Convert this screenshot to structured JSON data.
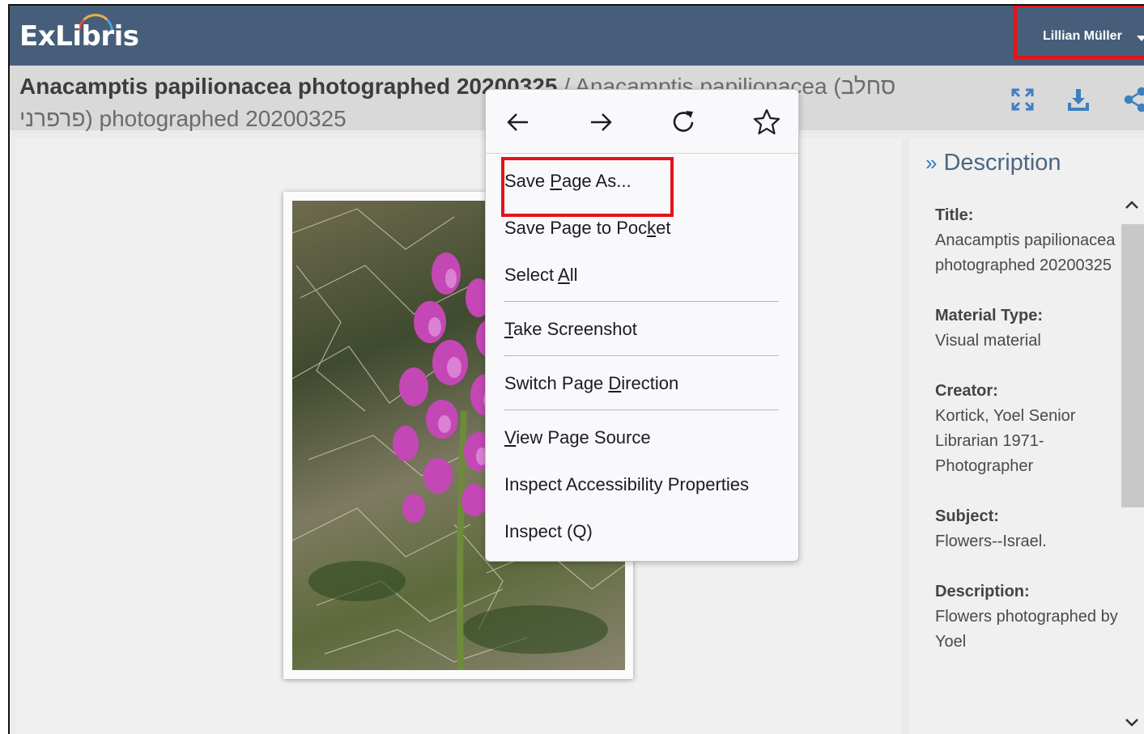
{
  "header": {
    "logo_text": "ExLibris",
    "user_name": "Lillian Müller"
  },
  "title": {
    "main": "Anacamptis papilionacea photographed 20200325",
    "separator": " / ",
    "alt": "Anacamptis papilionacea (סחלב פרפרני) photographed 20200325"
  },
  "toolbar": {
    "icons": [
      "fullscreen-icon",
      "download-icon",
      "share-icon"
    ]
  },
  "context_menu": {
    "nav": [
      "back-arrow-icon",
      "forward-arrow-icon",
      "reload-icon",
      "bookmark-star-icon"
    ],
    "items": {
      "save_page_as": {
        "before": "Save ",
        "key": "P",
        "after": "age As..."
      },
      "save_to_pocket": {
        "before": "Save Page to Poc",
        "key": "k",
        "after": "et"
      },
      "select_all": {
        "before": "Select ",
        "key": "A",
        "after": "ll"
      },
      "take_screenshot": {
        "before": "",
        "key": "T",
        "after": "ake Screenshot"
      },
      "switch_direction": {
        "before": "Switch Page ",
        "key": "D",
        "after": "irection"
      },
      "view_source": {
        "before": "",
        "key": "V",
        "after": "iew Page Source"
      },
      "inspect_accessibility": "Inspect Accessibility Properties",
      "inspect": "Inspect (Q)"
    }
  },
  "description": {
    "header": "Description",
    "fields": [
      {
        "label": "Title:",
        "value": "Anacamptis papilionacea photographed 20200325"
      },
      {
        "label": "Material Type:",
        "value": "Visual material"
      },
      {
        "label": "Creator:",
        "value": "Kortick, Yoel Senior Librarian 1971- Photographer"
      },
      {
        "label": "Subject:",
        "value": "Flowers--Israel."
      },
      {
        "label": "Description:",
        "value": "Flowers photographed by Yoel"
      }
    ]
  },
  "colors": {
    "header_bg": "#465e79",
    "highlight": "#e3131b",
    "accent_blue": "#2f7bc4"
  }
}
